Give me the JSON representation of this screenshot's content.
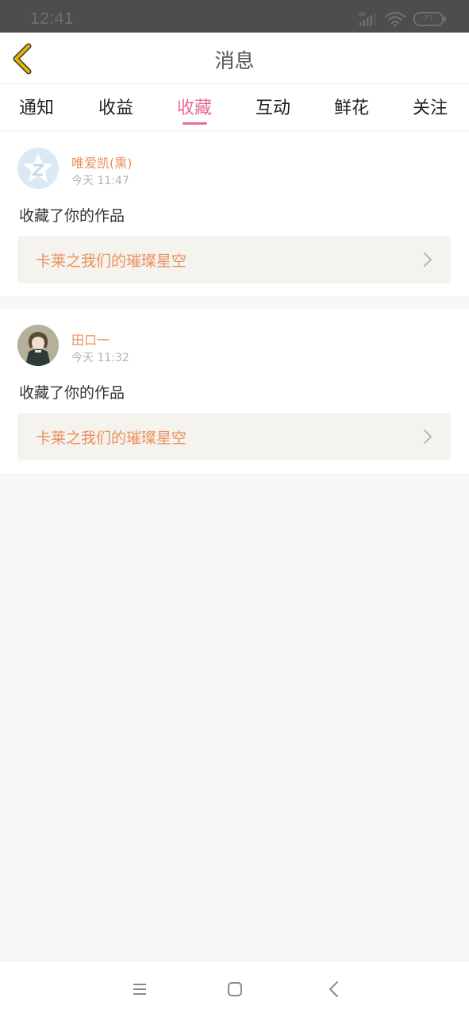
{
  "status_bar": {
    "time": "12:41",
    "network_label": "HD",
    "battery": "77",
    "icons": [
      "signal-icon",
      "wifi-icon",
      "battery-icon"
    ]
  },
  "header": {
    "title": "消息",
    "back_icon": "chevron-left-icon",
    "accent_color": "#e8b400"
  },
  "tabs": {
    "items": [
      {
        "label": "通知"
      },
      {
        "label": "收益"
      },
      {
        "label": "收藏"
      },
      {
        "label": "互动"
      },
      {
        "label": "鲜花"
      },
      {
        "label": "关注"
      }
    ],
    "active_index": 2,
    "active_color": "#e86a9a"
  },
  "notifications": [
    {
      "username": "唯爱凯(熏)",
      "time": "今天 11:47",
      "action": "收藏了你的作品",
      "work_title": "卡莱之我们的璀璨星空",
      "avatar_icon": "default-star-avatar-icon"
    },
    {
      "username": "田口一",
      "time": "今天 11:32",
      "action": "收藏了你的作品",
      "work_title": "卡莱之我们的璀璨星空",
      "avatar_icon": "anime-character-avatar"
    }
  ],
  "nav_bar": {
    "icons": [
      "menu-icon",
      "home-icon",
      "back-icon"
    ]
  },
  "colors": {
    "username": "#ec8f5f",
    "work_link_bg": "#f4f3ed",
    "page_bg": "#f8f6f6"
  }
}
